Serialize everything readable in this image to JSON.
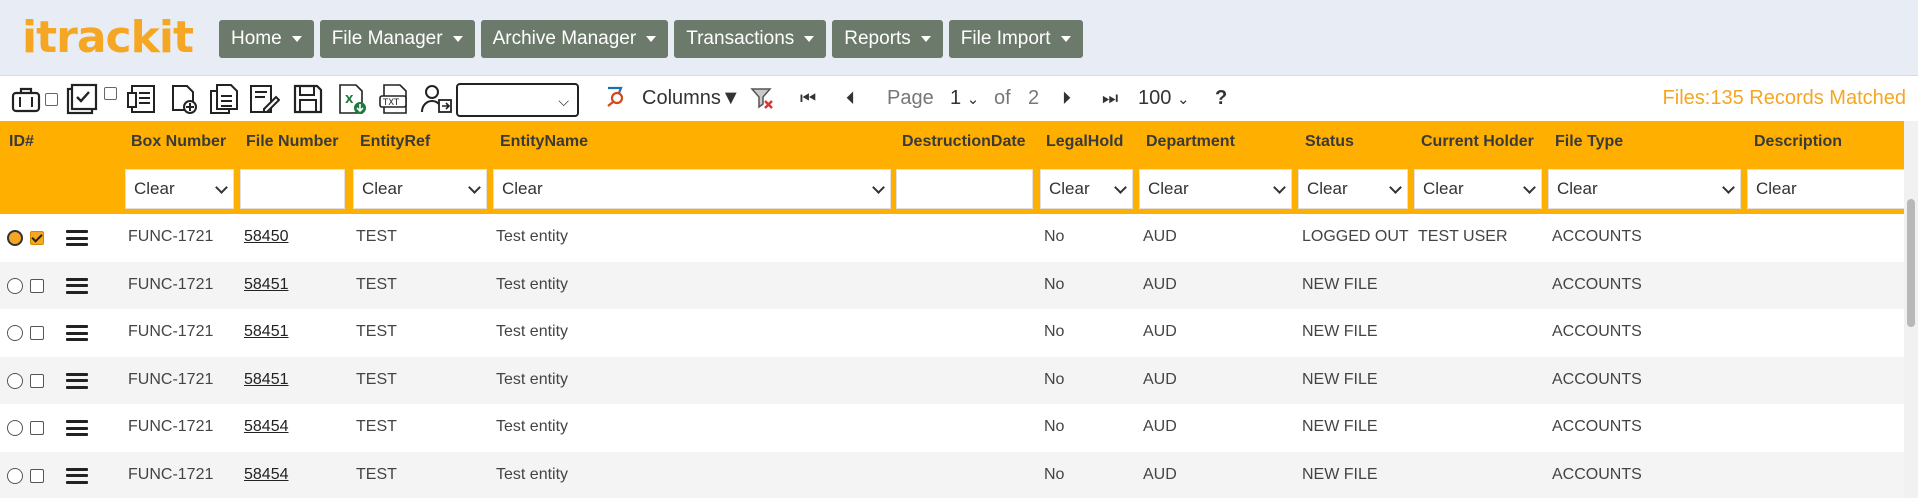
{
  "app": {
    "logo_prefix": "itrack",
    "logo_suffix": "it"
  },
  "nav": {
    "menus": [
      "Home",
      "File Manager",
      "Archive Manager",
      "Transactions",
      "Reports",
      "File Import"
    ]
  },
  "toolbar": {
    "icons": [
      "briefcase-icon",
      "checklist-icon",
      "report-icon",
      "add-file-icon",
      "documents-icon",
      "edit-icon",
      "save-icon",
      "excel-export-icon",
      "txt-export-icon",
      "user-transfer-icon"
    ],
    "view_select_value": "",
    "columns_label": "Columns▼",
    "page_label": "Page",
    "page_current": "1",
    "of_label": "of",
    "page_total": "2",
    "page_size": "100",
    "help_label": "?",
    "files_matched": "Files:135 Records Matched",
    "accent": "#f5a623"
  },
  "table": {
    "header_color": "#ffaf00",
    "columns": [
      "ID#",
      "Box Number",
      "File Number",
      "EntityRef",
      "EntityName",
      "DestructionDate",
      "LegalHold",
      "Department",
      "Status",
      "Current Holder",
      "File Type",
      "Description"
    ],
    "filters": {
      "box_number": "Clear",
      "file_number": "",
      "entity_ref": "Clear",
      "entity_name": "Clear",
      "destruction_date": "",
      "legal_hold": "Clear",
      "department": "Clear",
      "status": "Clear",
      "current_holder": "Clear",
      "file_type": "Clear",
      "description": "Clear"
    },
    "rows": [
      {
        "selected": true,
        "box": "FUNC-1721",
        "file": "58450",
        "ref": "TEST",
        "name": "Test entity",
        "destruction": "",
        "legal": "No",
        "dept": "AUD",
        "status": "LOGGED OUT",
        "holder": "TEST USER",
        "type": "ACCOUNTS",
        "desc": ""
      },
      {
        "selected": false,
        "box": "FUNC-1721",
        "file": "58451",
        "ref": "TEST",
        "name": "Test entity",
        "destruction": "",
        "legal": "No",
        "dept": "AUD",
        "status": "NEW FILE",
        "holder": "",
        "type": "ACCOUNTS",
        "desc": ""
      },
      {
        "selected": false,
        "box": "FUNC-1721",
        "file": "58451",
        "ref": "TEST",
        "name": "Test entity",
        "destruction": "",
        "legal": "No",
        "dept": "AUD",
        "status": "NEW FILE",
        "holder": "",
        "type": "ACCOUNTS",
        "desc": ""
      },
      {
        "selected": false,
        "box": "FUNC-1721",
        "file": "58451",
        "ref": "TEST",
        "name": "Test entity",
        "destruction": "",
        "legal": "No",
        "dept": "AUD",
        "status": "NEW FILE",
        "holder": "",
        "type": "ACCOUNTS",
        "desc": ""
      },
      {
        "selected": false,
        "box": "FUNC-1721",
        "file": "58454",
        "ref": "TEST",
        "name": "Test entity",
        "destruction": "",
        "legal": "No",
        "dept": "AUD",
        "status": "NEW FILE",
        "holder": "",
        "type": "ACCOUNTS",
        "desc": ""
      },
      {
        "selected": false,
        "box": "FUNC-1721",
        "file": "58454",
        "ref": "TEST",
        "name": "Test entity",
        "destruction": "",
        "legal": "No",
        "dept": "AUD",
        "status": "NEW FILE",
        "holder": "",
        "type": "ACCOUNTS",
        "desc": ""
      }
    ]
  }
}
